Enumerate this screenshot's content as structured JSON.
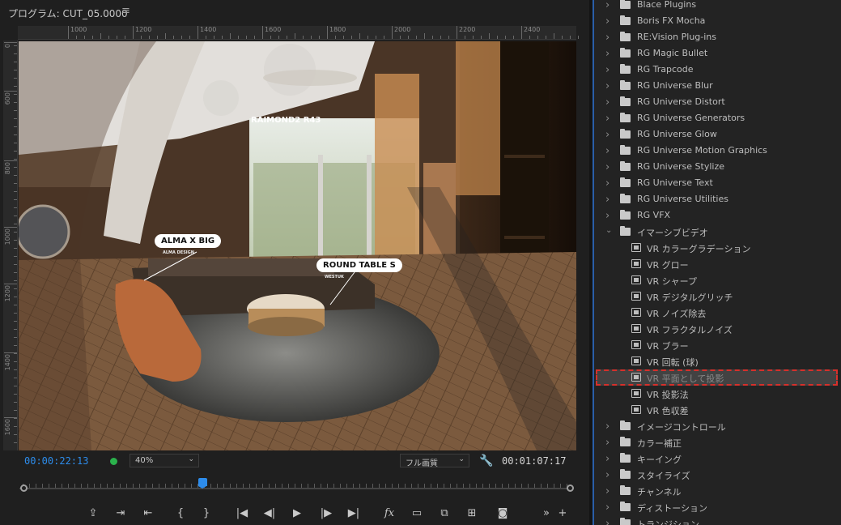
{
  "monitor": {
    "title": "プログラム: CUT_05.0000",
    "menu_icon": "≡",
    "ruler_h_labels": [
      "1000",
      "1200",
      "1400",
      "1600",
      "1800",
      "2000",
      "2200",
      "2400"
    ],
    "ruler_v_labels": [
      "0",
      "600",
      "800",
      "1000",
      "1200",
      "1400",
      "1600"
    ],
    "labels": {
      "raimond": "RAIMOND2 R43",
      "alma": "ALMA X BIG",
      "alma_sub": "ALMA DESIGN",
      "round_table": "ROUND TABLE S",
      "round_table_sub": "WESTUK"
    }
  },
  "transport": {
    "current_time": "00:00:22:13",
    "zoom": "40%",
    "quality": "フル画質",
    "duration": "00:01:07:17",
    "playhead_fraction": 0.33,
    "buttons": [
      {
        "name": "export-frame-button",
        "glyph": "⇪"
      },
      {
        "name": "mark-in-button",
        "glyph": "⇥"
      },
      {
        "name": "mark-out-button",
        "glyph": "⇤"
      },
      {
        "name": "go-to-in-bracket-button",
        "glyph": "{"
      },
      {
        "name": "go-to-out-bracket-button",
        "glyph": "}"
      },
      {
        "name": "go-to-in-button",
        "glyph": "|◀"
      },
      {
        "name": "step-back-button",
        "glyph": "◀|"
      },
      {
        "name": "play-button",
        "glyph": "▶"
      },
      {
        "name": "step-forward-button",
        "glyph": "|▶"
      },
      {
        "name": "go-to-out-button",
        "glyph": "▶|"
      },
      {
        "name": "fx-button",
        "glyph": "fx"
      },
      {
        "name": "safe-margins-button",
        "glyph": "▭"
      },
      {
        "name": "lift-button",
        "glyph": "⧉"
      },
      {
        "name": "extract-button",
        "glyph": "⊞"
      },
      {
        "name": "camera-button",
        "glyph": "◙"
      },
      {
        "name": "more-button",
        "glyph": "»"
      },
      {
        "name": "add-button",
        "glyph": "+"
      }
    ]
  },
  "effects": {
    "items": [
      {
        "label": "Blace Plugins",
        "type": "folder",
        "expanded": false
      },
      {
        "label": "Boris FX Mocha",
        "type": "folder",
        "expanded": false
      },
      {
        "label": "RE:Vision Plug-ins",
        "type": "folder",
        "expanded": false
      },
      {
        "label": "RG Magic Bullet",
        "type": "folder",
        "expanded": false
      },
      {
        "label": "RG Trapcode",
        "type": "folder",
        "expanded": false
      },
      {
        "label": "RG Universe Blur",
        "type": "folder",
        "expanded": false
      },
      {
        "label": "RG Universe Distort",
        "type": "folder",
        "expanded": false
      },
      {
        "label": "RG Universe Generators",
        "type": "folder",
        "expanded": false
      },
      {
        "label": "RG Universe Glow",
        "type": "folder",
        "expanded": false
      },
      {
        "label": "RG Universe Motion Graphics",
        "type": "folder",
        "expanded": false
      },
      {
        "label": "RG Universe Stylize",
        "type": "folder",
        "expanded": false
      },
      {
        "label": "RG Universe Text",
        "type": "folder",
        "expanded": false
      },
      {
        "label": "RG Universe Utilities",
        "type": "folder",
        "expanded": false
      },
      {
        "label": "RG VFX",
        "type": "folder",
        "expanded": false
      },
      {
        "label": "イマーシブビデオ",
        "type": "folder",
        "expanded": true
      },
      {
        "label": "VR カラーグラデーション",
        "type": "effect"
      },
      {
        "label": "VR グロー",
        "type": "effect"
      },
      {
        "label": "VR シャープ",
        "type": "effect"
      },
      {
        "label": "VR デジタルグリッチ",
        "type": "effect"
      },
      {
        "label": "VR ノイズ除去",
        "type": "effect"
      },
      {
        "label": "VR フラクタルノイズ",
        "type": "effect"
      },
      {
        "label": "VR ブラー",
        "type": "effect"
      },
      {
        "label": "VR 回転 (球)",
        "type": "effect"
      },
      {
        "label": "VR 平面として投影",
        "type": "effect",
        "selected": true
      },
      {
        "label": "VR 投影法",
        "type": "effect"
      },
      {
        "label": "VR 色収差",
        "type": "effect"
      },
      {
        "label": "イメージコントロール",
        "type": "folder",
        "expanded": false
      },
      {
        "label": "カラー補正",
        "type": "folder",
        "expanded": false
      },
      {
        "label": "キーイング",
        "type": "folder",
        "expanded": false
      },
      {
        "label": "スタイライズ",
        "type": "folder",
        "expanded": false
      },
      {
        "label": "チャンネル",
        "type": "folder",
        "expanded": false
      },
      {
        "label": "ディストーション",
        "type": "folder",
        "expanded": false
      },
      {
        "label": "トランジション",
        "type": "folder",
        "expanded": false
      }
    ]
  },
  "colors": {
    "accent_blue": "#2d8ceb",
    "highlight_red": "#d6302b",
    "panel_bg": "#232323"
  }
}
